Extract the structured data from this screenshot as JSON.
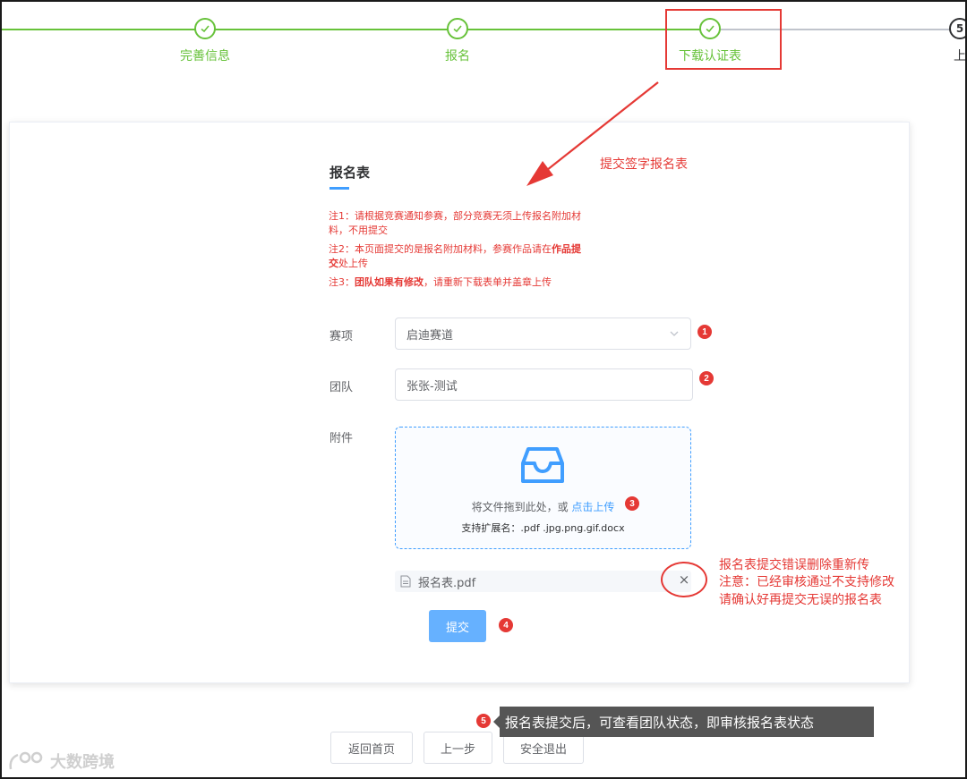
{
  "steps": {
    "items": [
      {
        "label": "完善信息",
        "status": "done"
      },
      {
        "label": "报名",
        "status": "done"
      },
      {
        "label": "下载认证表",
        "status": "done"
      },
      {
        "number": "5",
        "label": "上",
        "status": "todo"
      }
    ]
  },
  "form": {
    "title": "报名表",
    "notes": {
      "note1": "注1：请根据竞赛通知参赛，部分竞赛无须上传报名附加材料，不用提交",
      "note2_prefix": "注2：本页面提交的是报名附加材料，参赛作品请在",
      "note2_bold": "作品提交",
      "note2_suffix": "处上传",
      "note3_prefix": "注3：",
      "note3_bold": "团队如果有修改",
      "note3_suffix": "，请重新下载表单并盖章上传"
    },
    "event_label": "赛项",
    "event_value": "启迪赛道",
    "team_label": "团队",
    "team_value": "张张-测试",
    "attachment_label": "附件",
    "upload_hint": "将文件拖到此处，或",
    "upload_link": "点击上传",
    "upload_ext": "支持扩展名：.pdf .jpg.png.gif.docx",
    "file_name": "报名表.pdf",
    "file_remove": "×",
    "submit_label": "提交"
  },
  "annotations": {
    "submit_signed": "提交签字报名表",
    "error_line1": "报名表提交错误删除重新传",
    "error_line2": "注意：已经审核通过不支持修改",
    "error_line3": "请确认好再提交无误的报名表",
    "badges": [
      "1",
      "2",
      "3",
      "4",
      "5"
    ],
    "tooltip": "报名表提交后，可查看团队状态，即审核报名表状态"
  },
  "nav": {
    "home_label": "返回首页",
    "prev_label": "上一步",
    "logout_label": "安全退出"
  },
  "watermark": {
    "text": "大数跨境"
  },
  "colors": {
    "success": "#67c23a",
    "primary": "#409eff",
    "annotation": "#e53935"
  }
}
